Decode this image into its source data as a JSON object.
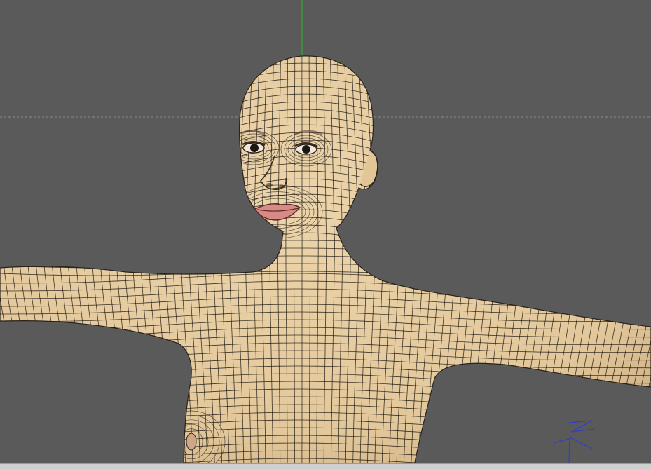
{
  "viewport": {
    "background": "#5a5a5a",
    "skin_color": "#e8cfa4",
    "skin_shadow": "#cdb286",
    "wire_color": "#1f1a14",
    "lip_color": "#d98a86",
    "y_axis_color": "#2fa82f",
    "ground_line_color": "#8a8a8a",
    "gizmo_color": "#2f3fc8"
  },
  "model": {
    "name_icon": "wireframe-mesh-icon"
  },
  "axis_gizmo": {
    "icon": "axis-gizmo-icon",
    "label": "Z"
  }
}
